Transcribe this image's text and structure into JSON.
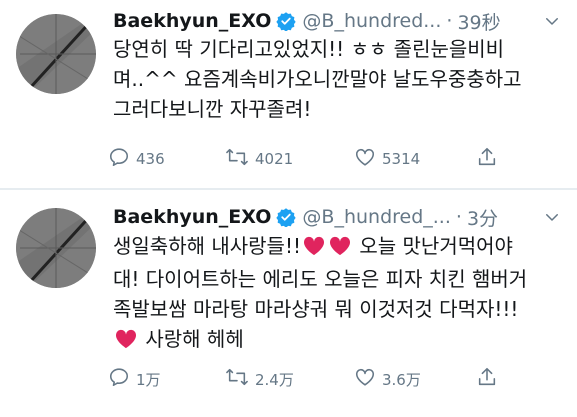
{
  "tweets": [
    {
      "author_name": "Baekhyun_EXO",
      "handle": "@B_hundred...",
      "separator": "·",
      "time": "39秒",
      "text_lines": [
        "당연히 딱 기다리고있었지!! ㅎㅎ 졸린눈을비비",
        "며..^^ 요즘계속비가오니깐말야 날도우중충하고",
        "그러다보니깐 자꾸졸려!"
      ],
      "counts": {
        "replies": "436",
        "retweets": "4021",
        "likes": "5314"
      }
    },
    {
      "author_name": "Baekhyun_EXO",
      "handle": "@B_hundred_...",
      "separator": "·",
      "time": "3分",
      "text_lines": [
        {
          "pre": "생일축하해 내사랑들!!",
          "post": " 오늘 맛난거먹어야"
        },
        "대! 다이어트하는 에리도 오늘은 피자 치킨 햄버거",
        "족발보쌈 마라탕 마라샹궈 뭐 이것저것 다먹자!!!",
        {
          "pre": "",
          "post": " 사랑해 헤헤"
        }
      ],
      "counts": {
        "replies": "1万",
        "retweets": "2.4万",
        "likes": "3.6万"
      }
    }
  ],
  "colors": {
    "verified": "#1da1f2",
    "heart": "#e0245e",
    "muted": "#657786",
    "text": "#14171a"
  },
  "icons": [
    "avatar-image",
    "verified-badge-icon",
    "chevron-down-icon",
    "reply-icon",
    "retweet-icon",
    "like-icon",
    "share-icon",
    "heart-emoji"
  ]
}
